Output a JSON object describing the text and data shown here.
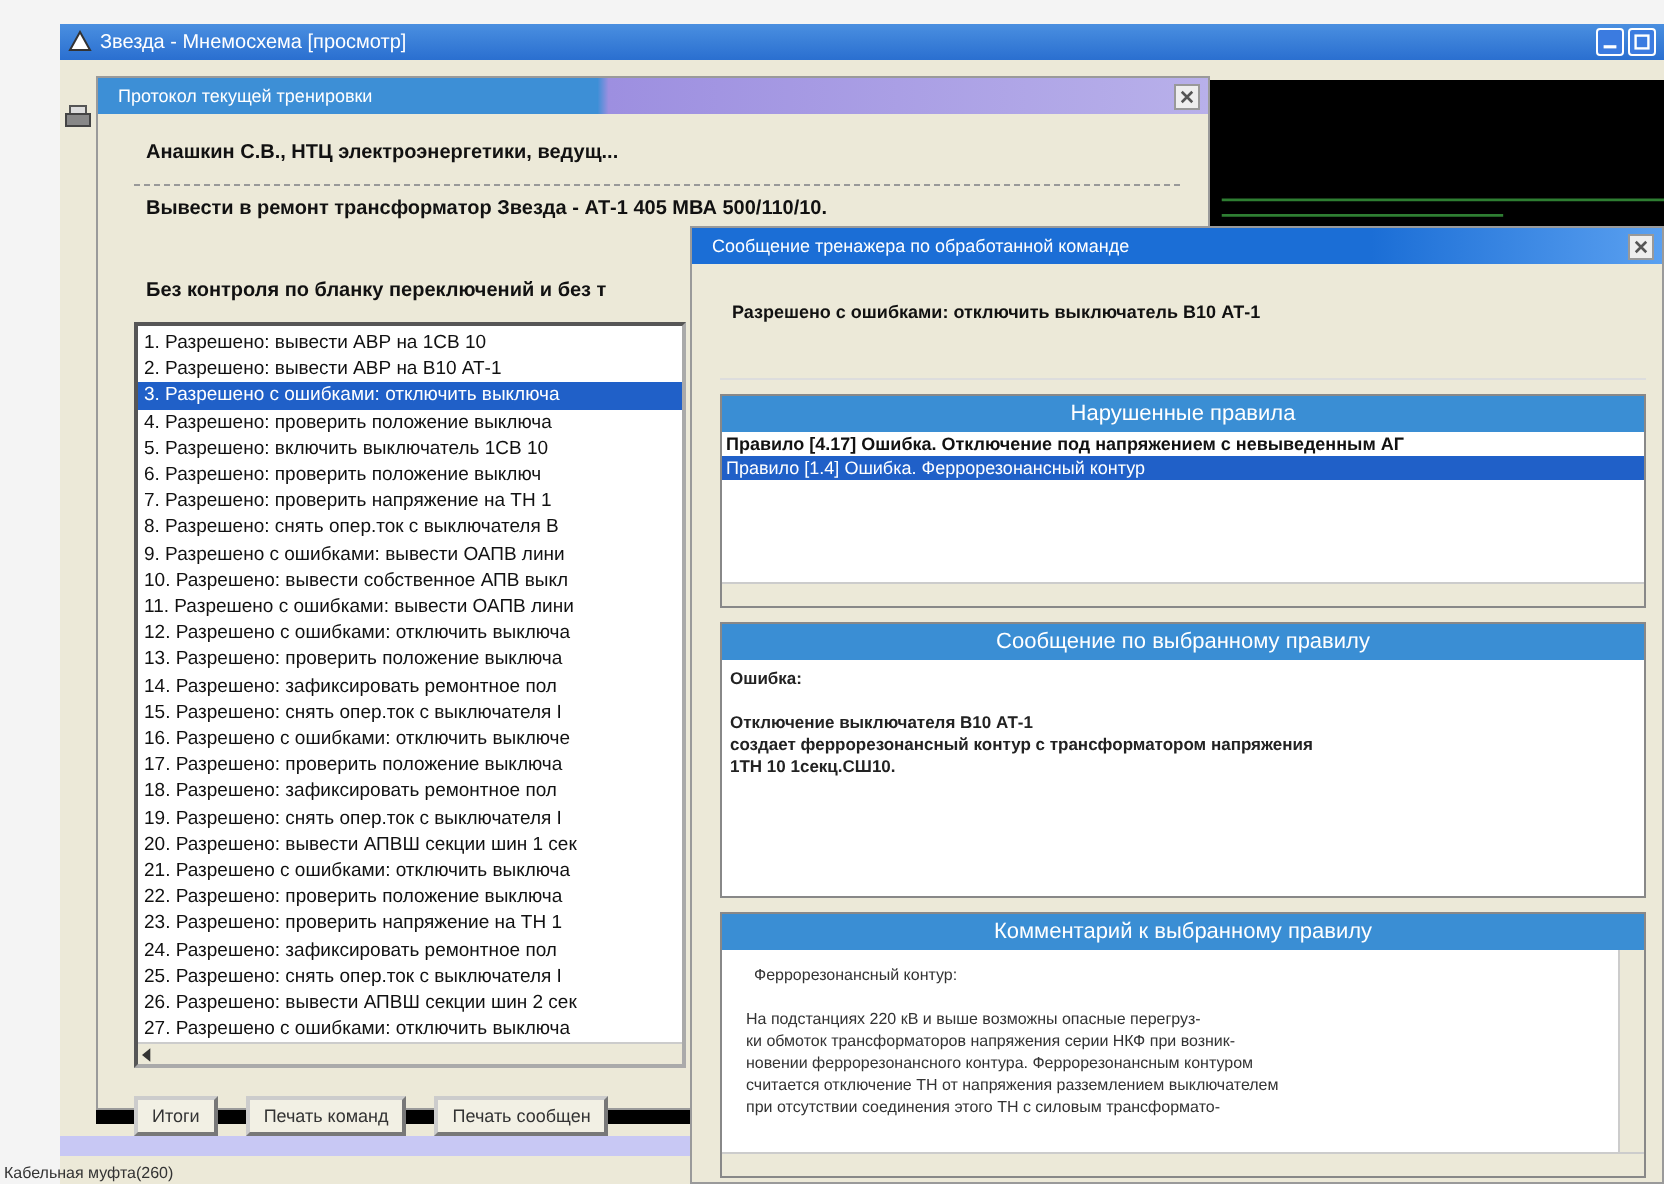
{
  "window": {
    "title": "Звезда - Мнемосхема [просмотр]"
  },
  "status_bar": "Кабельная муфта(260)",
  "protocol": {
    "title": "Протокол текущей тренировки",
    "trainee": "Анашкин С.В., НТЦ электроэнергетики, ведущ...",
    "task": "Вывести в ремонт трансформатор Звезда - АТ-1 405 МВА 500/110/10.",
    "mode": "Без контроля по бланку переключений и без т",
    "commands": [
      {
        "text": "1. Разрешено: вывести АВР на 1СВ 10",
        "selected": false
      },
      {
        "text": "2. Разрешено: вывести АВР на В10 АТ-1",
        "selected": false
      },
      {
        "text": "3. Разрешено с ошибками: отключить выключа",
        "selected": true
      },
      {
        "text": "4. Разрешено: проверить положение выключа",
        "selected": false
      },
      {
        "text": "5. Разрешено: включить выключатель 1СВ 10",
        "selected": false
      },
      {
        "text": "6. Разрешено: проверить положение выключ",
        "selected": false
      },
      {
        "text": "7. Разрешено: проверить напряжение на ТН 1",
        "selected": false
      },
      {
        "text": "8. Разрешено: снять опер.ток с выключателя В",
        "selected": false
      },
      {
        "text": "9. Разрешено с ошибками: вывести ОАПВ лини",
        "selected": false
      },
      {
        "text": "10. Разрешено: вывести собственное АПВ выкл",
        "selected": false
      },
      {
        "text": "11. Разрешено с ошибками: вывести ОАПВ лини",
        "selected": false
      },
      {
        "text": "12. Разрешено с ошибками: отключить выключа",
        "selected": false
      },
      {
        "text": "13. Разрешено: проверить положение выключа",
        "selected": false
      },
      {
        "text": "14. Разрешено: зафиксировать ремонтное пол",
        "selected": false
      },
      {
        "text": "15. Разрешено: снять опер.ток с выключателя I",
        "selected": false
      },
      {
        "text": "16. Разрешено с ошибками: отключить выключе",
        "selected": false
      },
      {
        "text": "17. Разрешено: проверить положение выключа",
        "selected": false
      },
      {
        "text": "18. Разрешено: зафиксировать ремонтное пол",
        "selected": false
      },
      {
        "text": "19. Разрешено: снять опер.ток с выключателя I",
        "selected": false
      },
      {
        "text": "20. Разрешено: вывести АПВШ секции шин 1 сек",
        "selected": false
      },
      {
        "text": "21. Разрешено с ошибками: отключить выключа",
        "selected": false
      },
      {
        "text": "22. Разрешено: проверить положение выключа",
        "selected": false
      },
      {
        "text": "23. Разрешено: проверить напряжение на ТН 1",
        "selected": false
      },
      {
        "text": "24. Разрешено: зафиксировать ремонтное пол",
        "selected": false
      },
      {
        "text": "25. Разрешено: снять опер.ток с выключателя I",
        "selected": false
      },
      {
        "text": "26. Разрешено: вывести АПВШ секции шин 2 сек",
        "selected": false
      },
      {
        "text": "27. Разрешено с ошибками: отключить выключа",
        "selected": false
      }
    ],
    "buttons": [
      "Итоги",
      "Печать команд",
      "Печать сообщен"
    ]
  },
  "message": {
    "title": "Сообщение тренажера по обработанной команде",
    "command": "Разрешено с ошибками: отключить выключатель В10 АТ-1",
    "rules_header": "Нарушенные правила",
    "rules": [
      {
        "code": "Правило [4.17]",
        "text": "Ошибка. Отключение под напряжением с невыведенным АГ",
        "selected": false
      },
      {
        "code": "Правило [1.4]",
        "text": "Ошибка. Феррорезонансный контур",
        "selected": true
      }
    ],
    "rule_message_header": "Сообщение по выбранному правилу",
    "rule_message_label": "Ошибка:",
    "rule_message": [
      "Отключение выключателя В10 АТ-1",
      "создает феррорезонансный контур с трансформатором напряжения",
      "1ТН 10 1секц.СШ10."
    ],
    "comment_header": "Комментарий к выбранному правилу",
    "comment_title": "Феррорезонансный контур:",
    "comment_lines": [
      "На подстанциях 220 кВ и выше возможны опасные перегруз-",
      "ки обмоток трансформаторов напряжения серии НКФ при возник-",
      "новении феррорезонансного контура. Феррорезонансным контуром",
      "считается отключение ТН от напряжения разземлением выключателем",
      "при отсутствии соединения этого ТН с силовым трансформато-"
    ]
  }
}
